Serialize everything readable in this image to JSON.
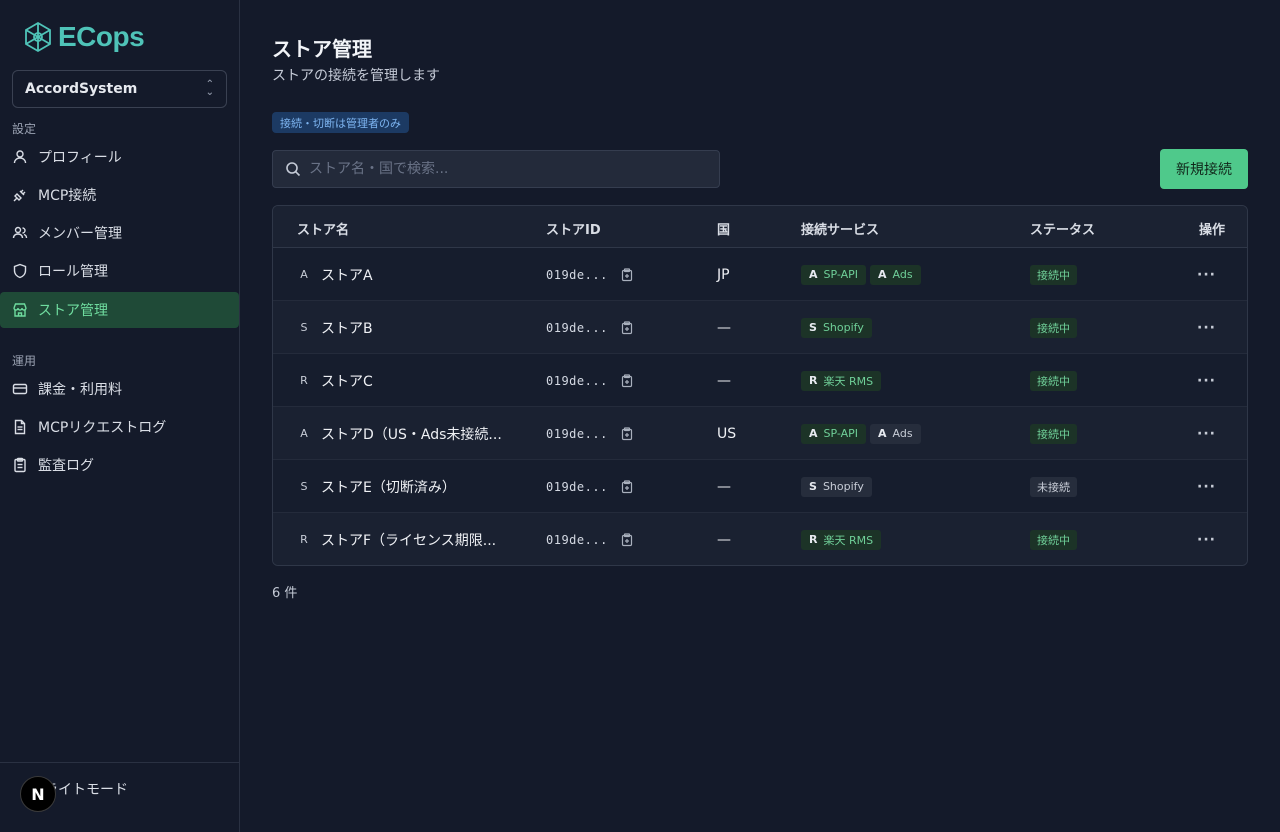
{
  "brand": {
    "name": "ECops"
  },
  "org": {
    "name": "AccordSystem"
  },
  "sidebar": {
    "settings_label": "設定",
    "settings_items": [
      {
        "label": "プロフィール",
        "icon": "user-icon"
      },
      {
        "label": "MCP接続",
        "icon": "plug-icon"
      },
      {
        "label": "メンバー管理",
        "icon": "users-icon"
      },
      {
        "label": "ロール管理",
        "icon": "shield-icon"
      },
      {
        "label": "ストア管理",
        "icon": "store-icon",
        "active": true
      }
    ],
    "ops_label": "運用",
    "ops_items": [
      {
        "label": "課金・利用料",
        "icon": "credit-card-icon"
      },
      {
        "label": "MCPリクエストログ",
        "icon": "file-text-icon"
      },
      {
        "label": "監査ログ",
        "icon": "clipboard-icon"
      }
    ],
    "theme_toggle": "ライトモード",
    "badge": "N"
  },
  "header": {
    "title": "ストア管理",
    "subtitle": "ストアの接続を管理します",
    "admin_note": "接続・切断は管理者のみ"
  },
  "search": {
    "placeholder": "ストア名・国で検索..."
  },
  "new_button": "新規接続",
  "table": {
    "columns": [
      "ストア名",
      "ストアID",
      "国",
      "接続サービス",
      "ステータス",
      "操作"
    ],
    "rows": [
      {
        "icon": "A",
        "name": "ストアA",
        "id": "019de...",
        "country": "JP",
        "services": [
          {
            "letter": "A",
            "label": "SP-API",
            "on": true
          },
          {
            "letter": "A",
            "label": "Ads",
            "on": true
          }
        ],
        "status": "接続中",
        "status_on": true
      },
      {
        "icon": "S",
        "name": "ストアB",
        "id": "019de...",
        "country": "—",
        "services": [
          {
            "letter": "S",
            "label": "Shopify",
            "on": true
          }
        ],
        "status": "接続中",
        "status_on": true
      },
      {
        "icon": "R",
        "name": "ストアC",
        "id": "019de...",
        "country": "—",
        "services": [
          {
            "letter": "R",
            "label": "楽天 RMS",
            "on": true
          }
        ],
        "status": "接続中",
        "status_on": true
      },
      {
        "icon": "A",
        "name": "ストアD（US・Ads未接続...",
        "id": "019de...",
        "country": "US",
        "services": [
          {
            "letter": "A",
            "label": "SP-API",
            "on": true
          },
          {
            "letter": "A",
            "label": "Ads",
            "on": false
          }
        ],
        "status": "接続中",
        "status_on": true
      },
      {
        "icon": "S",
        "name": "ストアE（切断済み）",
        "id": "019de...",
        "country": "—",
        "services": [
          {
            "letter": "S",
            "label": "Shopify",
            "on": false
          }
        ],
        "status": "未接続",
        "status_on": false
      },
      {
        "icon": "R",
        "name": "ストアF（ライセンス期限...",
        "id": "019de...",
        "country": "—",
        "services": [
          {
            "letter": "R",
            "label": "楽天 RMS",
            "on": true
          }
        ],
        "status": "接続中",
        "status_on": true
      }
    ],
    "actions_label": "···"
  },
  "count_text": "6 件"
}
